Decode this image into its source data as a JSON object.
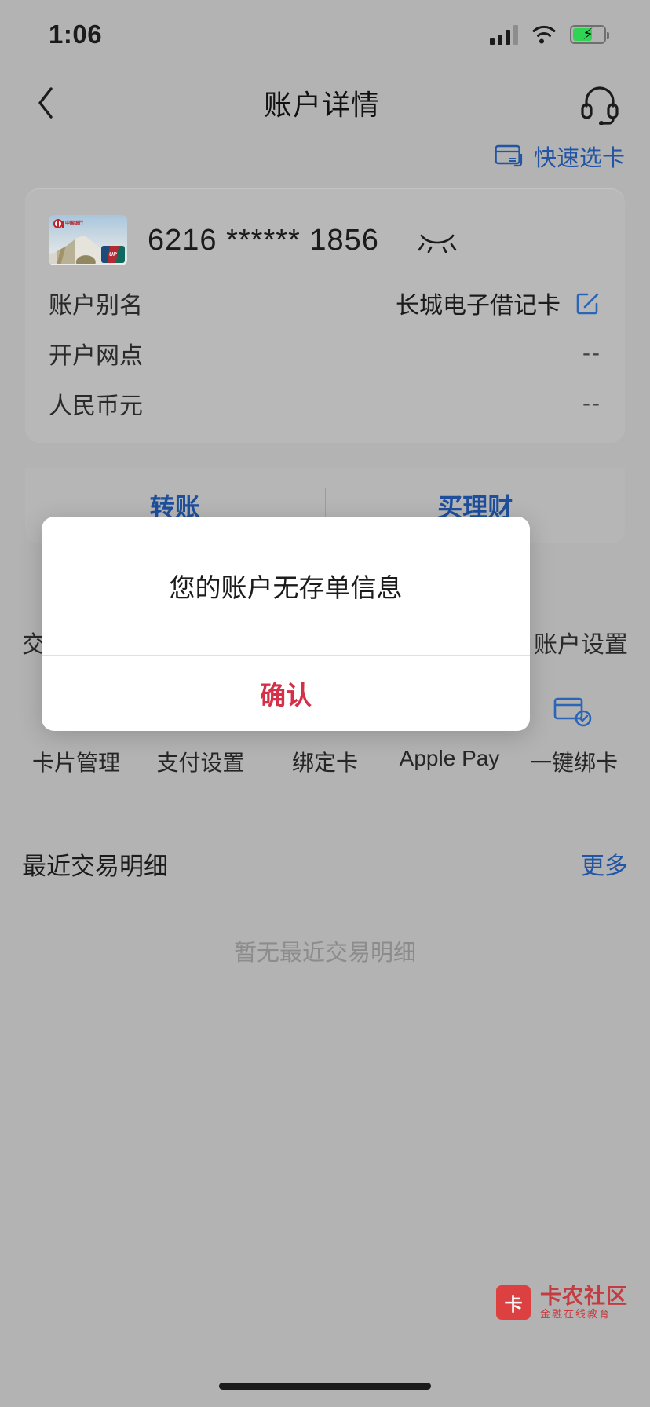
{
  "status_bar": {
    "time": "1:06",
    "signal_icon": "cellular-signal-icon",
    "wifi_icon": "wifi-icon",
    "battery_icon": "battery-charging-icon"
  },
  "header": {
    "back_icon": "chevron-left-icon",
    "title": "账户详情",
    "support_icon": "headset-icon"
  },
  "quick_select": {
    "icon": "card-switch-icon",
    "label": "快速选卡"
  },
  "account_card": {
    "card_art": {
      "bank_logo": "bank-of-china-logo",
      "bank_name": "中国银行",
      "network_badge": "unionpay-logo"
    },
    "number": "6216 ****** 1856",
    "visibility_icon": "eye-closed-icon",
    "rows": [
      {
        "label": "账户别名",
        "value": "长城电子借记卡",
        "edit_icon": "edit-pencil-icon"
      },
      {
        "label": "开户网点",
        "value": "--"
      },
      {
        "label": "人民币元",
        "value": "--"
      }
    ]
  },
  "actions": [
    {
      "label": "转账"
    },
    {
      "label": "买理财"
    }
  ],
  "service_row": {
    "left": "交易明细",
    "right": "账户设置"
  },
  "icon_grid": [
    {
      "icon": "card-management-icon",
      "label": "卡片管理"
    },
    {
      "icon": "payment-settings-icon",
      "label": "支付设置"
    },
    {
      "icon": "bind-card-icon",
      "label": "绑定卡"
    },
    {
      "icon": "apple-pay-icon",
      "label": "Apple Pay"
    },
    {
      "icon": "one-click-bind-icon",
      "label": "一键绑卡"
    }
  ],
  "recent": {
    "title": "最近交易明细",
    "more": "更多",
    "empty_text": "暂无最近交易明细"
  },
  "dialog": {
    "message": "您的账户无存单信息",
    "confirm_label": "确认",
    "confirm_color": "#d4304a"
  },
  "watermark": {
    "badge": "卡",
    "name": "卡农社区",
    "tagline": "金融在线教育"
  },
  "colors": {
    "background": "#b3b3b3",
    "accent_blue": "#2255a4",
    "action_blue": "#1e4f9c",
    "danger_red": "#d4304a"
  }
}
